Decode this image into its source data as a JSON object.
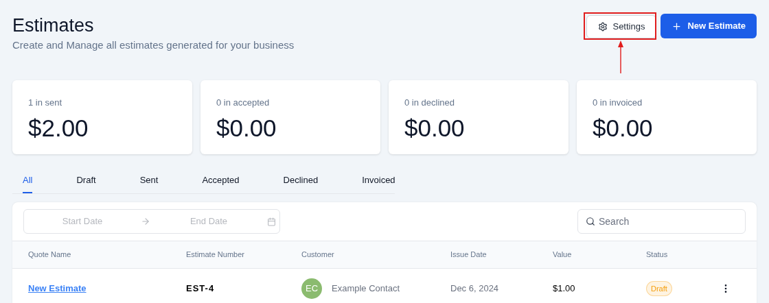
{
  "header": {
    "title": "Estimates",
    "subtitle": "Create and Manage all estimates generated for your business"
  },
  "actions": {
    "settings": {
      "label": "Settings",
      "highlighted": true
    },
    "new_estimate": {
      "label": "New Estimate"
    }
  },
  "stats": [
    {
      "label": "1 in sent",
      "amount": "$2.00"
    },
    {
      "label": "0 in accepted",
      "amount": "$0.00"
    },
    {
      "label": "0 in declined",
      "amount": "$0.00"
    },
    {
      "label": "0 in invoiced",
      "amount": "$0.00"
    }
  ],
  "tabs": [
    {
      "label": "All",
      "selected": true
    },
    {
      "label": "Draft",
      "selected": false
    },
    {
      "label": "Sent",
      "selected": false
    },
    {
      "label": "Accepted",
      "selected": false
    },
    {
      "label": "Declined",
      "selected": false
    },
    {
      "label": "Invoiced",
      "selected": false
    }
  ],
  "date_range": {
    "start_placeholder": "Start Date",
    "end_placeholder": "End Date"
  },
  "search": {
    "placeholder": "Search"
  },
  "table": {
    "columns": [
      "Quote Name",
      "Estimate Number",
      "Customer",
      "Issue Date",
      "Value",
      "Status"
    ],
    "rows": [
      {
        "quote_name": "New Estimate",
        "estimate_number": "EST-4",
        "customer_initials": "EC",
        "customer": "Example Contact",
        "issue_date": "Dec 6, 2024",
        "value": "$1.00",
        "status": "Draft",
        "color": "#f59e0b"
      }
    ]
  }
}
